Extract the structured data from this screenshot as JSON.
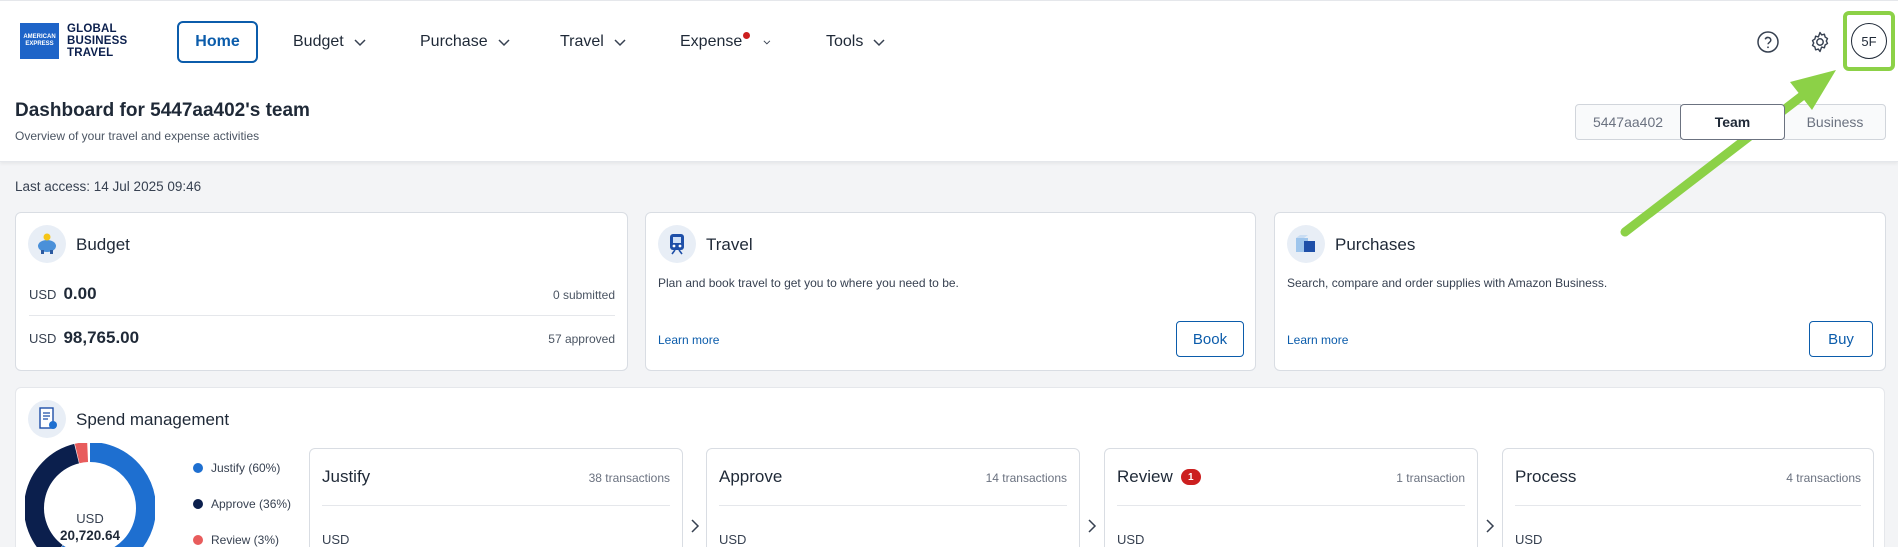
{
  "brand": {
    "logo_box_line1": "AMERICAN",
    "logo_box_line2": "EXPRESS",
    "line1": "GLOBAL",
    "line2": "BUSINESS",
    "line3": "TRAVEL"
  },
  "nav": {
    "home": "Home",
    "budget": "Budget",
    "purchase": "Purchase",
    "travel": "Travel",
    "expense": "Expense",
    "tools": "Tools"
  },
  "icons": {
    "help": "help-circle-icon",
    "settings": "gear-icon"
  },
  "user": {
    "initials": "5F"
  },
  "header": {
    "title": "Dashboard for 5447aa402's team",
    "subtitle": "Overview of your travel and expense activities",
    "segments": [
      "5447aa402",
      "Team",
      "Business"
    ],
    "active_segment": "Team"
  },
  "last_access": "Last access: 14 Jul 2025 09:46",
  "budget_card": {
    "title": "Budget",
    "rows": [
      {
        "currency": "USD",
        "amount": "0.00",
        "note": "0 submitted"
      },
      {
        "currency": "USD",
        "amount": "98,765.00",
        "note": "57 approved"
      }
    ]
  },
  "travel_card": {
    "title": "Travel",
    "description": "Plan and book travel to get you to where you need to be.",
    "link": "Learn more",
    "button": "Book"
  },
  "purchases_card": {
    "title": "Purchases",
    "description": "Search, compare and order supplies with Amazon Business.",
    "link": "Learn more",
    "button": "Buy"
  },
  "spend": {
    "title": "Spend management",
    "donut": {
      "currency": "USD",
      "total": "20,720.64"
    },
    "legend": [
      {
        "label": "Justify (60%)",
        "color": "#1e6fd0",
        "pct": 60
      },
      {
        "label": "Approve (36%)",
        "color": "#0b1f4d",
        "pct": 36
      },
      {
        "label": "Review (3%)",
        "color": "#e85c5c",
        "pct": 3
      }
    ],
    "stages": [
      {
        "title": "Justify",
        "count": "38 transactions",
        "currency": "USD",
        "badge": ""
      },
      {
        "title": "Approve",
        "count": "14 transactions",
        "currency": "USD",
        "badge": ""
      },
      {
        "title": "Review",
        "count": "1 transaction",
        "currency": "USD",
        "badge": "1"
      },
      {
        "title": "Process",
        "count": "4 transactions",
        "currency": "USD",
        "badge": ""
      }
    ]
  },
  "colors": {
    "accent": "#0b5cab",
    "annotation": "#8cd147",
    "alert": "#cc1f1f"
  }
}
